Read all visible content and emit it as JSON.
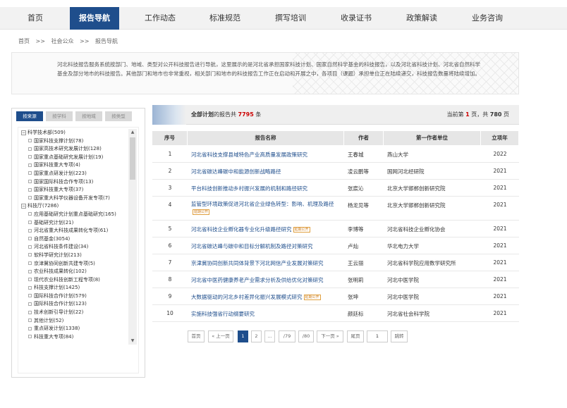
{
  "nav": {
    "items": [
      "首页",
      "报告导航",
      "工作动态",
      "标准规范",
      "撰写培训",
      "收录证书",
      "政策解读",
      "业务咨询"
    ]
  },
  "breadcrumb": [
    "首页",
    ">>",
    "社会公众",
    ">>",
    "报告导航"
  ],
  "intro": "河北科技报告服务系统按部门、地域、类型对公开科技报告进行导航，这里展示的是河北省承担国家科技计划、国家自然科学基金的科技报告，以及河北省科技计划、河北省自然科学基金及部分地市的科技报告。其他部门和地市也非常重视，相关部门和地市的科技报告工作正在启动和开展之中，各项目（课题）承担单位正在陆续递交，科技报告数量将陆续增加。",
  "left_tabs": [
    "按来源",
    "按学科",
    "按地域",
    "按类型"
  ],
  "tree": [
    {
      "type": "parent",
      "label": "科学技术部(509)"
    },
    {
      "type": "child",
      "label": "国家科技支撑计划(78)"
    },
    {
      "type": "child",
      "label": "国家高技术研究发展计划(128)"
    },
    {
      "type": "child",
      "label": "国家重点基础研究发展计划(19)"
    },
    {
      "type": "child",
      "label": "国家科技重大专项(4)"
    },
    {
      "type": "child",
      "label": "国家重点研发计划(223)"
    },
    {
      "type": "child",
      "label": "国家国际科技合作专项(13)"
    },
    {
      "type": "child",
      "label": "国家科技重大专项(37)"
    },
    {
      "type": "child",
      "label": "国家重大科学仪器设备开发专项(7)"
    },
    {
      "type": "parent",
      "label": "科技厅(7286)"
    },
    {
      "type": "child",
      "label": "应用基础研究计划重点基础研究(165)"
    },
    {
      "type": "child",
      "label": "基础研究计划(21)"
    },
    {
      "type": "child",
      "label": "河北省重大科技成果转化专项(61)"
    },
    {
      "type": "child",
      "label": "自然基金(3054)"
    },
    {
      "type": "child",
      "label": "河北省科技条件建设(34)"
    },
    {
      "type": "child",
      "label": "软科学研究计划(213)"
    },
    {
      "type": "child",
      "label": "京津冀协同创新共建专项(5)"
    },
    {
      "type": "child",
      "label": "农业科技成果转化(102)"
    },
    {
      "type": "child",
      "label": "现代农业科技创新工程专项(8)"
    },
    {
      "type": "child",
      "label": "科技支撑计划(1425)"
    },
    {
      "type": "child",
      "label": "国际科技合作计划(579)"
    },
    {
      "type": "child",
      "label": "国际科技合作计划(123)"
    },
    {
      "type": "child",
      "label": "技术创新引导计划(22)"
    },
    {
      "type": "child",
      "label": "其他计划(52)"
    },
    {
      "type": "child",
      "label": "重点研发计划(1338)"
    },
    {
      "type": "child",
      "label": "科技重大专项(84)"
    }
  ],
  "header": {
    "left_prefix": "全部计划",
    "left_mid": "的报告共 ",
    "total": "7795",
    "left_suffix": " 条",
    "right_prefix": "当前第 ",
    "page": "1",
    "right_mid": " 页，共 ",
    "pages": "780",
    "right_suffix": " 页"
  },
  "table": {
    "columns": [
      "序号",
      "报告名称",
      "作者",
      "第一作者单位",
      "立项年"
    ],
    "rows": [
      {
        "no": "1",
        "title": "河北省科技支撑县域特色产业高质量发展政策研究",
        "tag": "",
        "author": "王春城",
        "unit": "燕山大学",
        "year": "2022"
      },
      {
        "no": "2",
        "title": "河北省碳达峰碳中和能源创新战略路径",
        "tag": "",
        "author": "凌云鹏等",
        "unit": "国网河北经研院",
        "year": "2021"
      },
      {
        "no": "3",
        "title": "平台科技创新推动乡村振兴发展的机制和路径研究",
        "tag": "",
        "author": "张宸沁",
        "unit": "北京大学邯郸创新研究院",
        "year": "2021"
      },
      {
        "no": "4",
        "title": "监管型环境政策促进河北省企业绿色转型：影响、机理及路径",
        "tag": "延期公开",
        "author": "杨龙见等",
        "unit": "北京大学邯郸创新研究院",
        "year": "2021"
      },
      {
        "no": "5",
        "title": "河北省科技企业孵化器专业化升级路径研究",
        "tag": "延期公开",
        "author": "李博等",
        "unit": "河北省科技企业孵化协会",
        "year": "2021"
      },
      {
        "no": "6",
        "title": "河北省碳达峰与碳中和目标分解机制及路径对策研究",
        "tag": "",
        "author": "卢灿",
        "unit": "华北电力大学",
        "year": "2021"
      },
      {
        "no": "7",
        "title": "京津冀协同创新共同体背景下河北网信产业发展对策研究",
        "tag": "",
        "author": "王云丽",
        "unit": "河北省科学院应用数学研究所",
        "year": "2021"
      },
      {
        "no": "8",
        "title": "河北省中医药健康养老产业需求分析及供给优化对策研究",
        "tag": "",
        "author": "张明莉",
        "unit": "河北中医学院",
        "year": "2021"
      },
      {
        "no": "9",
        "title": "大数据驱动的河北乡村差异化振兴发展模式研究",
        "tag": "延期公开",
        "author": "张坤",
        "unit": "河北中医学院",
        "year": "2021"
      },
      {
        "no": "10",
        "title": "实施科技强省行动纲要研究",
        "tag": "",
        "author": "颜廷标",
        "unit": "河北省社会科学院",
        "year": "2021"
      }
    ]
  },
  "pager": {
    "first": "首页",
    "prev": "« 上一页",
    "p1": "1",
    "p2": "2",
    "ellipsis": "...",
    "p79": "/79",
    "p80": "/80",
    "next": "下一页 »",
    "last": "尾页",
    "jump_value": "1",
    "jump": "跳转"
  },
  "colors": {
    "primary": "#1f4e8c",
    "highlight": "#cc0000"
  }
}
